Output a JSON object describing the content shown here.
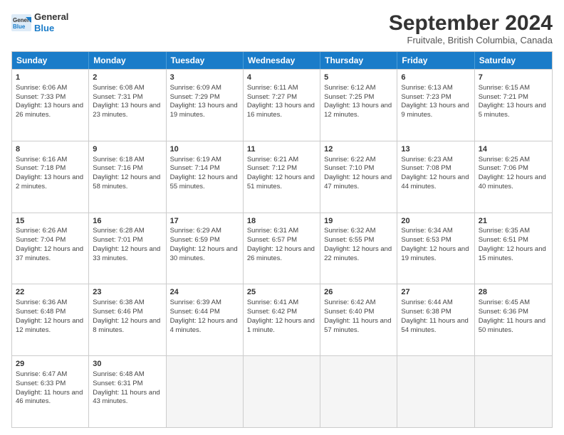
{
  "logo": {
    "line1": "General",
    "line2": "Blue"
  },
  "title": "September 2024",
  "location": "Fruitvale, British Columbia, Canada",
  "weekdays": [
    "Sunday",
    "Monday",
    "Tuesday",
    "Wednesday",
    "Thursday",
    "Friday",
    "Saturday"
  ],
  "rows": [
    [
      {
        "day": "1",
        "sunrise": "Sunrise: 6:06 AM",
        "sunset": "Sunset: 7:33 PM",
        "daylight": "Daylight: 13 hours and 26 minutes."
      },
      {
        "day": "2",
        "sunrise": "Sunrise: 6:08 AM",
        "sunset": "Sunset: 7:31 PM",
        "daylight": "Daylight: 13 hours and 23 minutes."
      },
      {
        "day": "3",
        "sunrise": "Sunrise: 6:09 AM",
        "sunset": "Sunset: 7:29 PM",
        "daylight": "Daylight: 13 hours and 19 minutes."
      },
      {
        "day": "4",
        "sunrise": "Sunrise: 6:11 AM",
        "sunset": "Sunset: 7:27 PM",
        "daylight": "Daylight: 13 hours and 16 minutes."
      },
      {
        "day": "5",
        "sunrise": "Sunrise: 6:12 AM",
        "sunset": "Sunset: 7:25 PM",
        "daylight": "Daylight: 13 hours and 12 minutes."
      },
      {
        "day": "6",
        "sunrise": "Sunrise: 6:13 AM",
        "sunset": "Sunset: 7:23 PM",
        "daylight": "Daylight: 13 hours and 9 minutes."
      },
      {
        "day": "7",
        "sunrise": "Sunrise: 6:15 AM",
        "sunset": "Sunset: 7:21 PM",
        "daylight": "Daylight: 13 hours and 5 minutes."
      }
    ],
    [
      {
        "day": "8",
        "sunrise": "Sunrise: 6:16 AM",
        "sunset": "Sunset: 7:18 PM",
        "daylight": "Daylight: 13 hours and 2 minutes."
      },
      {
        "day": "9",
        "sunrise": "Sunrise: 6:18 AM",
        "sunset": "Sunset: 7:16 PM",
        "daylight": "Daylight: 12 hours and 58 minutes."
      },
      {
        "day": "10",
        "sunrise": "Sunrise: 6:19 AM",
        "sunset": "Sunset: 7:14 PM",
        "daylight": "Daylight: 12 hours and 55 minutes."
      },
      {
        "day": "11",
        "sunrise": "Sunrise: 6:21 AM",
        "sunset": "Sunset: 7:12 PM",
        "daylight": "Daylight: 12 hours and 51 minutes."
      },
      {
        "day": "12",
        "sunrise": "Sunrise: 6:22 AM",
        "sunset": "Sunset: 7:10 PM",
        "daylight": "Daylight: 12 hours and 47 minutes."
      },
      {
        "day": "13",
        "sunrise": "Sunrise: 6:23 AM",
        "sunset": "Sunset: 7:08 PM",
        "daylight": "Daylight: 12 hours and 44 minutes."
      },
      {
        "day": "14",
        "sunrise": "Sunrise: 6:25 AM",
        "sunset": "Sunset: 7:06 PM",
        "daylight": "Daylight: 12 hours and 40 minutes."
      }
    ],
    [
      {
        "day": "15",
        "sunrise": "Sunrise: 6:26 AM",
        "sunset": "Sunset: 7:04 PM",
        "daylight": "Daylight: 12 hours and 37 minutes."
      },
      {
        "day": "16",
        "sunrise": "Sunrise: 6:28 AM",
        "sunset": "Sunset: 7:01 PM",
        "daylight": "Daylight: 12 hours and 33 minutes."
      },
      {
        "day": "17",
        "sunrise": "Sunrise: 6:29 AM",
        "sunset": "Sunset: 6:59 PM",
        "daylight": "Daylight: 12 hours and 30 minutes."
      },
      {
        "day": "18",
        "sunrise": "Sunrise: 6:31 AM",
        "sunset": "Sunset: 6:57 PM",
        "daylight": "Daylight: 12 hours and 26 minutes."
      },
      {
        "day": "19",
        "sunrise": "Sunrise: 6:32 AM",
        "sunset": "Sunset: 6:55 PM",
        "daylight": "Daylight: 12 hours and 22 minutes."
      },
      {
        "day": "20",
        "sunrise": "Sunrise: 6:34 AM",
        "sunset": "Sunset: 6:53 PM",
        "daylight": "Daylight: 12 hours and 19 minutes."
      },
      {
        "day": "21",
        "sunrise": "Sunrise: 6:35 AM",
        "sunset": "Sunset: 6:51 PM",
        "daylight": "Daylight: 12 hours and 15 minutes."
      }
    ],
    [
      {
        "day": "22",
        "sunrise": "Sunrise: 6:36 AM",
        "sunset": "Sunset: 6:48 PM",
        "daylight": "Daylight: 12 hours and 12 minutes."
      },
      {
        "day": "23",
        "sunrise": "Sunrise: 6:38 AM",
        "sunset": "Sunset: 6:46 PM",
        "daylight": "Daylight: 12 hours and 8 minutes."
      },
      {
        "day": "24",
        "sunrise": "Sunrise: 6:39 AM",
        "sunset": "Sunset: 6:44 PM",
        "daylight": "Daylight: 12 hours and 4 minutes."
      },
      {
        "day": "25",
        "sunrise": "Sunrise: 6:41 AM",
        "sunset": "Sunset: 6:42 PM",
        "daylight": "Daylight: 12 hours and 1 minute."
      },
      {
        "day": "26",
        "sunrise": "Sunrise: 6:42 AM",
        "sunset": "Sunset: 6:40 PM",
        "daylight": "Daylight: 11 hours and 57 minutes."
      },
      {
        "day": "27",
        "sunrise": "Sunrise: 6:44 AM",
        "sunset": "Sunset: 6:38 PM",
        "daylight": "Daylight: 11 hours and 54 minutes."
      },
      {
        "day": "28",
        "sunrise": "Sunrise: 6:45 AM",
        "sunset": "Sunset: 6:36 PM",
        "daylight": "Daylight: 11 hours and 50 minutes."
      }
    ],
    [
      {
        "day": "29",
        "sunrise": "Sunrise: 6:47 AM",
        "sunset": "Sunset: 6:33 PM",
        "daylight": "Daylight: 11 hours and 46 minutes."
      },
      {
        "day": "30",
        "sunrise": "Sunrise: 6:48 AM",
        "sunset": "Sunset: 6:31 PM",
        "daylight": "Daylight: 11 hours and 43 minutes."
      },
      {
        "day": "",
        "sunrise": "",
        "sunset": "",
        "daylight": ""
      },
      {
        "day": "",
        "sunrise": "",
        "sunset": "",
        "daylight": ""
      },
      {
        "day": "",
        "sunrise": "",
        "sunset": "",
        "daylight": ""
      },
      {
        "day": "",
        "sunrise": "",
        "sunset": "",
        "daylight": ""
      },
      {
        "day": "",
        "sunrise": "",
        "sunset": "",
        "daylight": ""
      }
    ]
  ]
}
